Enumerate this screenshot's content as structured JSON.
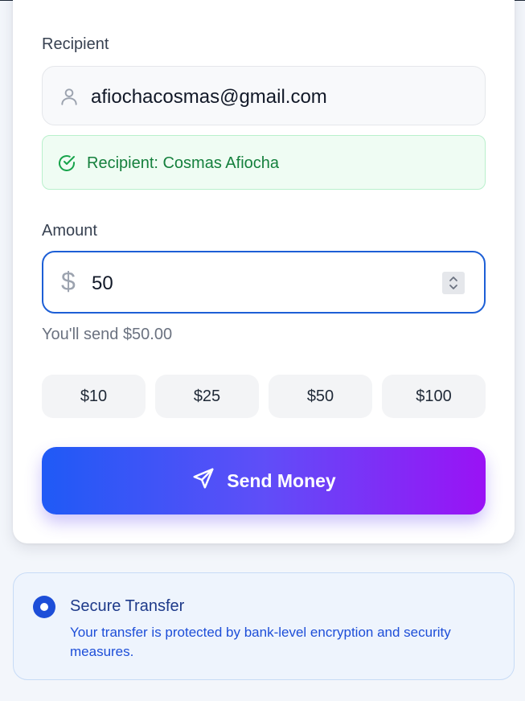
{
  "recipient": {
    "label": "Recipient",
    "email": "afiochacosmas@gmail.com",
    "verified_text": "Recipient: Cosmas Afiocha"
  },
  "amount": {
    "label": "Amount",
    "currency_symbol": "$",
    "value": "50",
    "summary": "You'll send $50.00"
  },
  "quick_amounts": [
    "$10",
    "$25",
    "$50",
    "$100"
  ],
  "send_button": {
    "label": "Send Money"
  },
  "secure_notice": {
    "title": "Secure Transfer",
    "description": "Your transfer is protected by bank-level encryption and security measures."
  },
  "colors": {
    "accent_blue": "#1d5fd6",
    "gradient_start": "#1f5af6",
    "gradient_end": "#9a12f5",
    "success_green": "#15803d"
  },
  "icons": {
    "recipient": "user-icon",
    "verified": "check-circle-icon",
    "send": "paper-plane-icon"
  }
}
